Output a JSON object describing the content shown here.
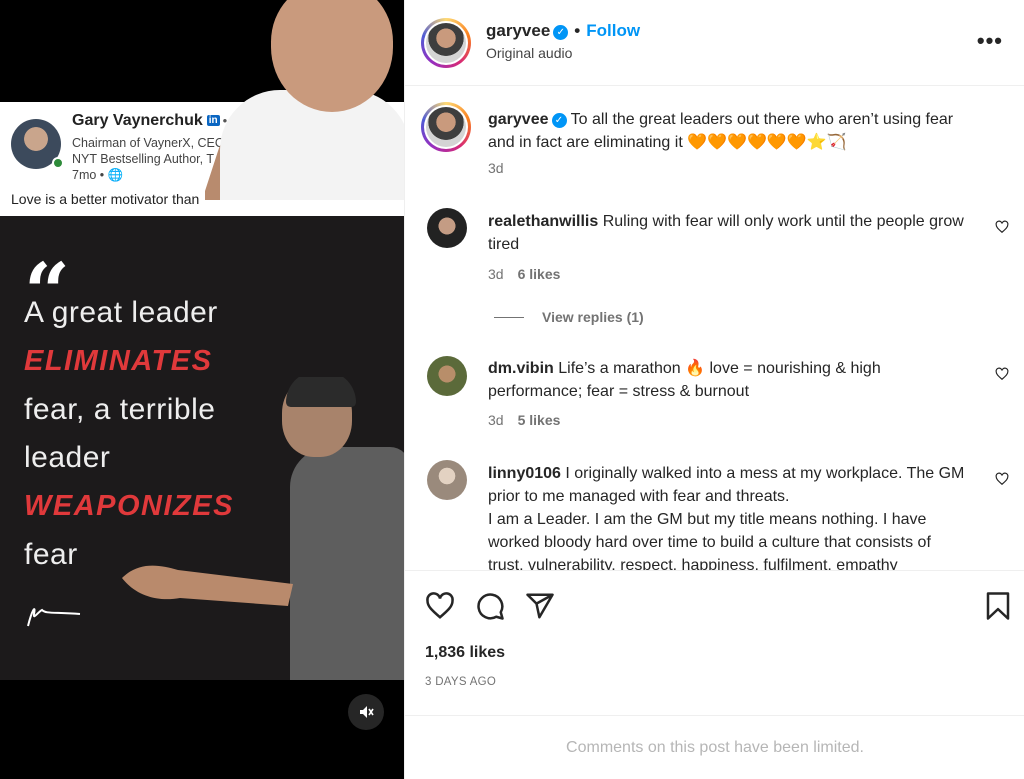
{
  "media": {
    "linkedin": {
      "name": "Gary Vaynerchuk",
      "badge": "in",
      "you": "• You",
      "line1": "Chairman of VaynerX, CEO of V",
      "line2": "NYT Bestselling Author, T",
      "line3": "7mo • 🌐",
      "text": "Love is a better motivator than"
    },
    "quote": {
      "mark": "“",
      "lines": [
        "A great leader",
        "ELIMINATES",
        "fear, a terrible",
        "leader",
        "WEAPONIZES",
        "fear"
      ]
    },
    "mute_icon": "speaker-muted-icon"
  },
  "header": {
    "username": "garyvee",
    "verified_icon": "verified-badge-icon",
    "separator": "•",
    "follow_label": "Follow",
    "subtitle": "Original audio",
    "more_label": "•••"
  },
  "caption": {
    "username": "garyvee",
    "text": "To all the great leaders out there who aren’t using fear and in fact are eliminating it 🧡🧡🧡🧡🧡🧡⭐🏹",
    "time": "3d"
  },
  "comments": [
    {
      "username": "realethanwillis",
      "text": "Ruling with fear will only work until the people grow tired",
      "time": "3d",
      "likes": "6 likes",
      "replies": "View replies (1)"
    },
    {
      "username": "dm.vibin",
      "text": "Life’s a marathon 🔥 love = nourishing & high performance; fear = stress & burnout",
      "time": "3d",
      "likes": "5 likes"
    },
    {
      "username": "linny0106",
      "text": "I originally walked into a mess at my workplace. The GM prior to me managed with fear and threats.",
      "text2": "I am a Leader. I am the GM but my title means nothing. I have worked bloody hard over time to build a culture that consists of trust, vulnerability, respect, happiness, fulfilment, empathy"
    }
  ],
  "actions": {
    "like_icon": "heart-icon",
    "comment_icon": "comment-icon",
    "share_icon": "send-icon",
    "save_icon": "bookmark-icon",
    "likes_count": "1,836 likes",
    "date": "3 DAYS AGO"
  },
  "footer": {
    "limited_text": "Comments on this post have been limited."
  }
}
